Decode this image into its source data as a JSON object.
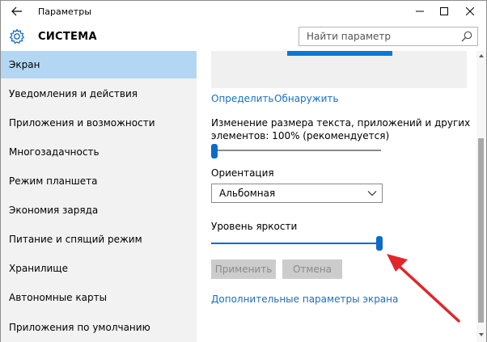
{
  "window": {
    "title": "Параметры"
  },
  "header": {
    "section_title": "СИСТЕМА",
    "search_placeholder": "Найти параметр"
  },
  "sidebar": {
    "items": [
      {
        "label": "Экран",
        "active": true
      },
      {
        "label": "Уведомления и действия",
        "active": false
      },
      {
        "label": "Приложения и возможности",
        "active": false
      },
      {
        "label": "Многозадачность",
        "active": false
      },
      {
        "label": "Режим планшета",
        "active": false
      },
      {
        "label": "Экономия заряда",
        "active": false
      },
      {
        "label": "Питание и спящий режим",
        "active": false
      },
      {
        "label": "Хранилище",
        "active": false
      },
      {
        "label": "Автономные карты",
        "active": false
      },
      {
        "label": "Приложения по умолчанию",
        "active": false
      }
    ]
  },
  "main": {
    "identify_link": "Определить",
    "detect_link": "Обнаружить",
    "scale_label_line1": "Изменение размера текста, приложений и других",
    "scale_label_line2": "элементов: 100% (рекомендуется)",
    "scale_slider_value": 0,
    "orientation_label": "Ориентация",
    "orientation_value": "Альбомная",
    "brightness_label": "Уровень яркости",
    "brightness_value": 100,
    "apply_button": "Применить",
    "cancel_button": "Отмена",
    "advanced_link": "Дополнительные параметры экрана"
  },
  "colors": {
    "accent": "#0a6cc9",
    "sidebar_active": "#b3d7f3",
    "link": "#1a6fc4",
    "annotation_arrow": "#e0262c"
  }
}
